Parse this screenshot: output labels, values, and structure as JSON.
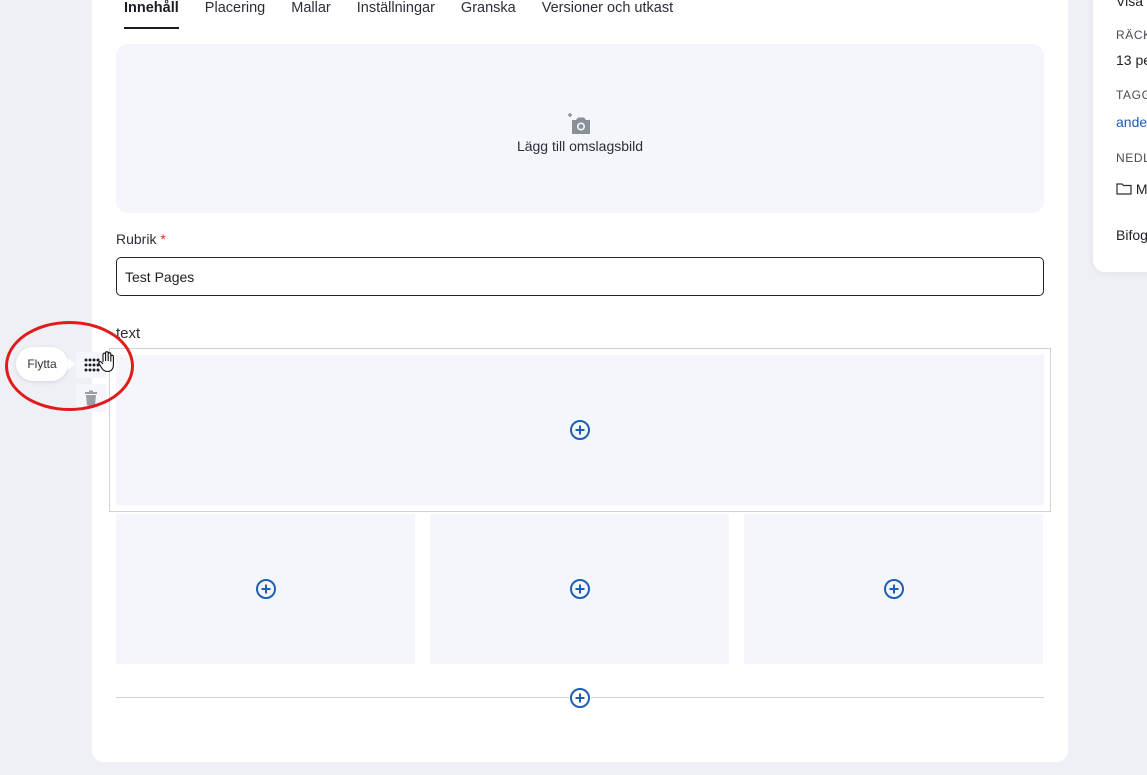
{
  "tabs": [
    {
      "label": "Innehåll",
      "active": true
    },
    {
      "label": "Placering"
    },
    {
      "label": "Mallar"
    },
    {
      "label": "Inställningar"
    },
    {
      "label": "Granska"
    },
    {
      "label": "Versioner och utkast"
    }
  ],
  "cover": {
    "label": "Lägg till omslagsbild",
    "icon": "add-photo-icon"
  },
  "title_field": {
    "label": "Rubrik",
    "required_marker": "*",
    "value": "Test Pages"
  },
  "section": {
    "label": "text"
  },
  "block_toolbar": {
    "tooltip": "Flytta",
    "drag_icon": "drag-grid-icon",
    "delete_icon": "trash-icon"
  },
  "side_panel": {
    "line0": "Visa",
    "reach_heading": "RÄCK",
    "reach_value": "13 pe",
    "tags_heading": "TAGG",
    "tags_value": "ande",
    "download_heading": "NEDL",
    "folder_value": "M",
    "attachments_label": "Bifog"
  },
  "colors": {
    "accent": "#1d5fb3",
    "highlight": "#e01b1b",
    "placeholder_bg": "#f5f6fb"
  }
}
